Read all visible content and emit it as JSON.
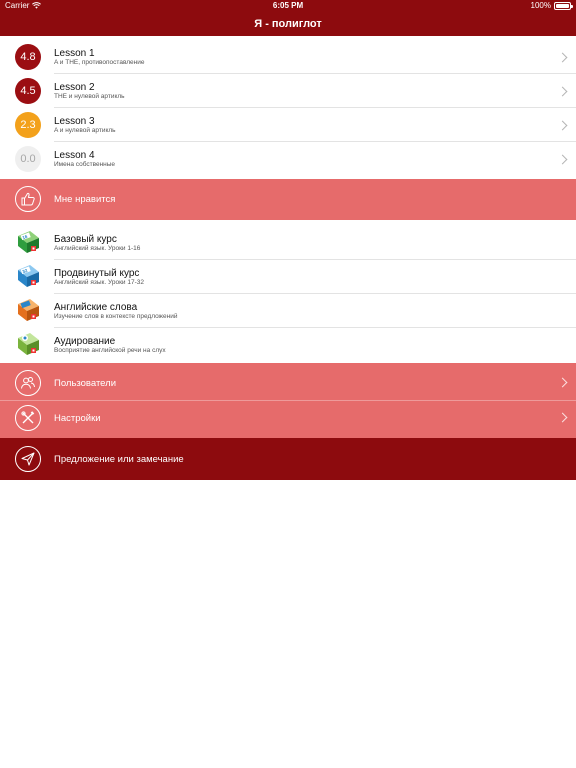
{
  "status_bar": {
    "carrier": "Carrier",
    "time": "6:05 PM",
    "battery": "100%"
  },
  "nav": {
    "title": "Я - полиглот"
  },
  "lessons": [
    {
      "score": "4.8",
      "title": "Lesson 1",
      "subtitle": "A и THE, противопоставление",
      "badge_color": "#9b0e12"
    },
    {
      "score": "4.5",
      "title": "Lesson 2",
      "subtitle": "THE и нулевой артикль",
      "badge_color": "#9b0e12"
    },
    {
      "score": "2.3",
      "title": "Lesson 3",
      "subtitle": "A и нулевой артикль",
      "badge_color": "#f3a11b"
    },
    {
      "score": "0.0",
      "title": "Lesson 4",
      "subtitle": "Имена собственные",
      "badge_color": "#efefef"
    }
  ],
  "like": {
    "label": "Мне нравится",
    "icon": "thumbs-up-icon"
  },
  "courses": [
    {
      "title": "Базовый курс",
      "subtitle": "Английский язык. Уроки 1-16",
      "book_label": "16",
      "book_color": "#2f9d3e"
    },
    {
      "title": "Продвинутый курс",
      "subtitle": "Английский язык. Уроки 17-32",
      "book_label": "32",
      "book_color": "#2a86c9"
    },
    {
      "title": "Английские слова",
      "subtitle": "Изучение слов в контексте предложений",
      "book_label": "",
      "book_color": "#e4701e"
    },
    {
      "title": "Аудирование",
      "subtitle": "Восприятие английской речи на слух",
      "book_label": "",
      "book_color": "#7ab33d"
    }
  ],
  "menu": [
    {
      "label": "Пользователи",
      "icon": "users-icon"
    },
    {
      "label": "Настройки",
      "icon": "tools-icon"
    }
  ],
  "feedback": {
    "label": "Предложение или замечание",
    "icon": "paper-plane-icon"
  },
  "colors": {
    "brand": "#8d0b0e",
    "band": "#e66b6b",
    "score_high": "#9b0e12",
    "score_mid": "#f3a11b"
  }
}
